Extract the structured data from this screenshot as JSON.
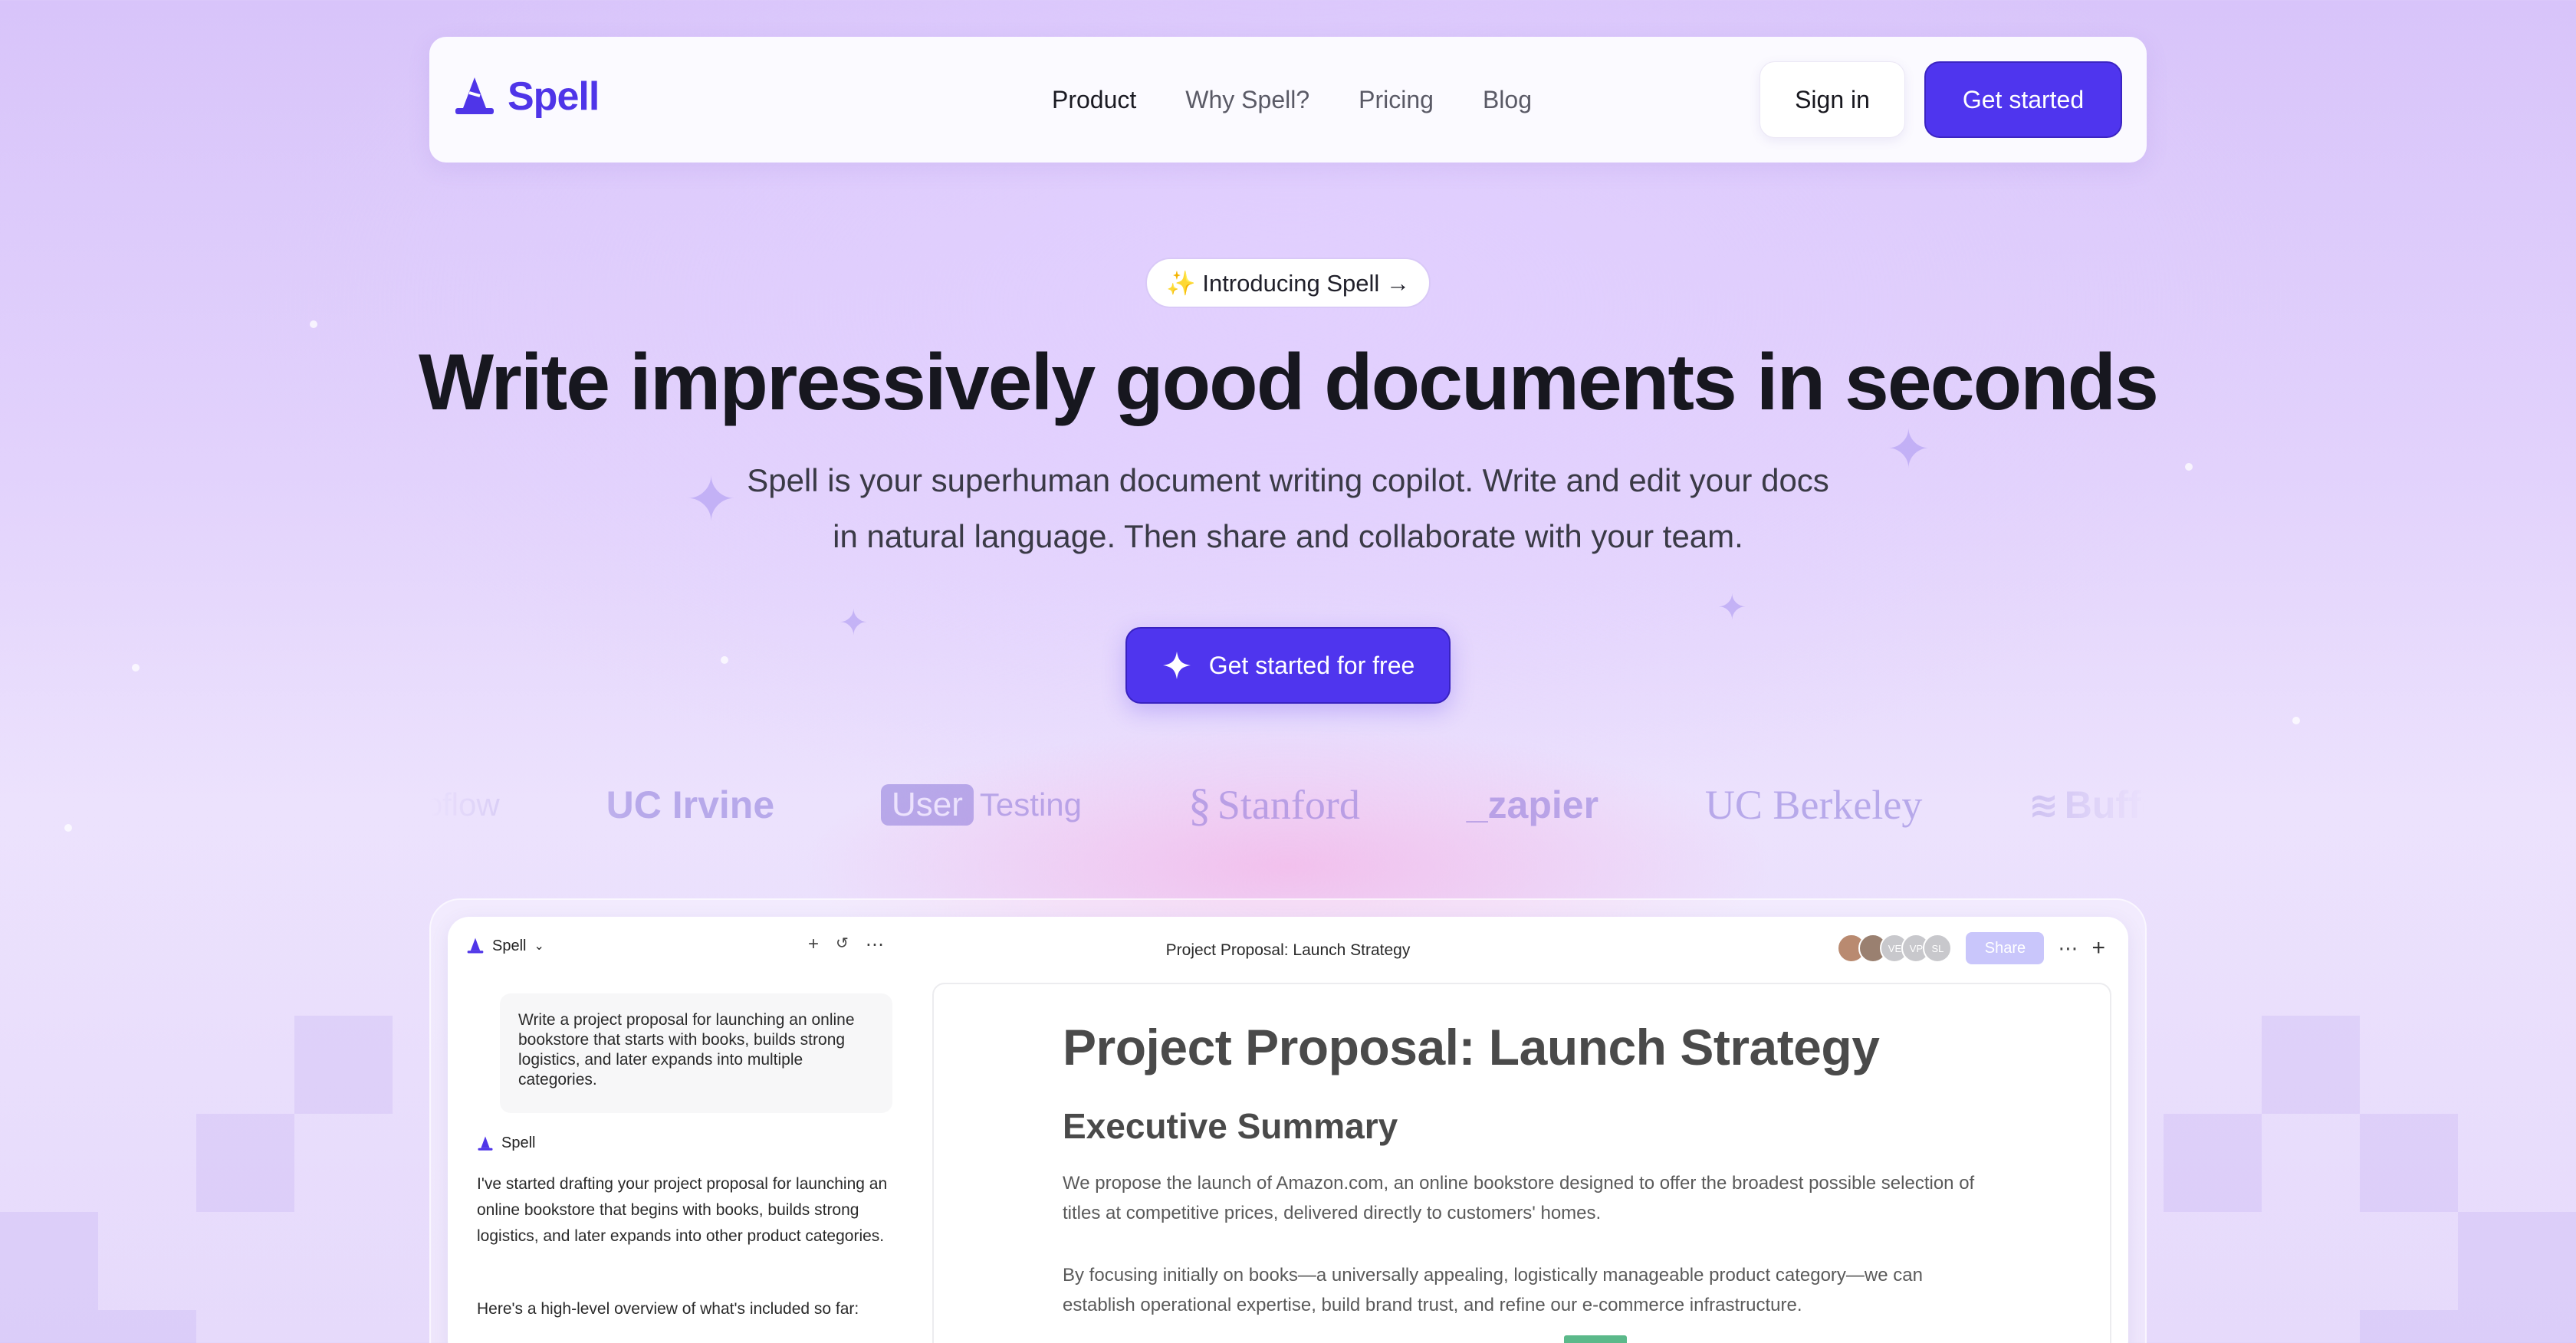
{
  "nav": {
    "logo_text": "Spell",
    "links": [
      "Product",
      "Why Spell?",
      "Pricing",
      "Blog"
    ],
    "signin_label": "Sign in",
    "getstarted_label": "Get started"
  },
  "hero": {
    "pill_text": "✨ Introducing Spell →",
    "title": "Write impressively good documents in seconds",
    "subtitle_line1": "Spell is your superhuman document writing copilot. Write and edit your docs",
    "subtitle_line2": "in natural language. Then share and collaborate with your team.",
    "cta_label": "Get started for free"
  },
  "logos": {
    "webflow": "webflow",
    "uc_irvine": "UC Irvine",
    "usertesting_box": "User",
    "usertesting_word": "Testing",
    "stanford": "Stanford",
    "zapier": "_zapier",
    "uc_berkeley": "UC Berkeley",
    "buffer": "Buffer"
  },
  "app": {
    "brand": "Spell",
    "doc_title_bar": "Project Proposal: Launch Strategy",
    "avatars": [
      "",
      "",
      "VE",
      "VP",
      "SL"
    ],
    "share_label": "Share",
    "prompt": "Write a project proposal for launching an online bookstore that starts with books, builds strong logistics, and later expands into multiple categories.",
    "assistant_name": "Spell",
    "assistant_reply": "I've started drafting your project proposal for launching an online bookstore that begins with books, builds strong logistics, and later expands into other product categories.",
    "assistant_reply2": "Here's a high-level overview of what's included so far:",
    "doc": {
      "title": "Project Proposal: Launch Strategy",
      "section": "Executive Summary",
      "para1": "We propose the launch of Amazon.com, an online bookstore designed to offer the broadest possible selection of titles at competitive prices, delivered directly to customers' homes.",
      "para2": "By focusing initially on books—a universally appealing, logistically manageable product category—we can establish operational expertise, build brand trust, and refine our e-commerce infrastructure."
    }
  },
  "colors": {
    "brand": "#4f35ee",
    "background": "#e2d2fc",
    "logos": "#9a8ad8"
  }
}
